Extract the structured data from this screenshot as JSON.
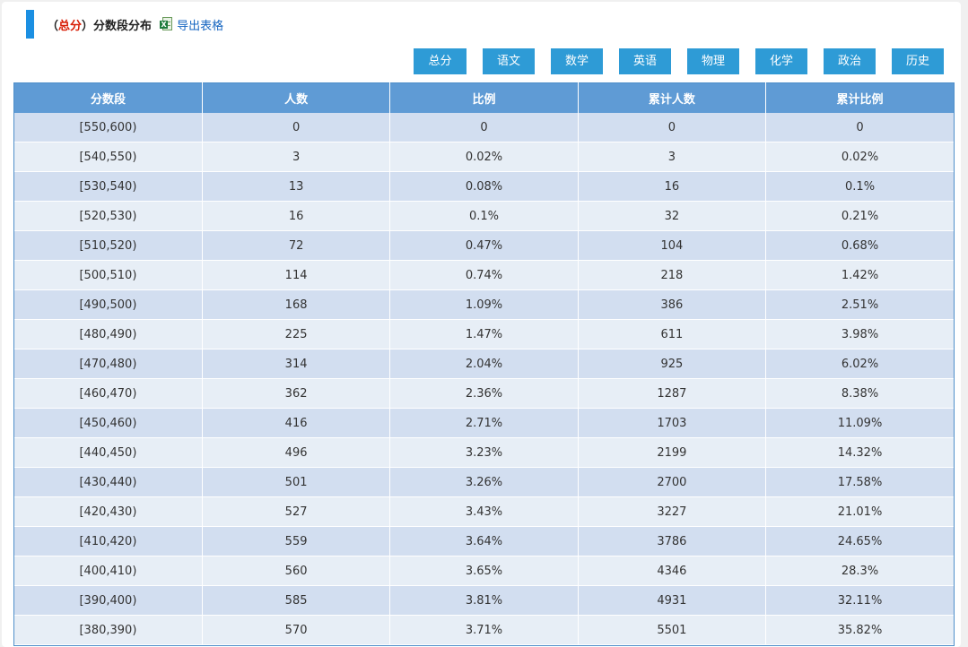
{
  "header": {
    "paren_open": "（",
    "subject": "总分",
    "paren_close": "）",
    "title": "分数段分布",
    "export_label": "导出表格",
    "export_icon": "excel-icon"
  },
  "subject_buttons": [
    "总分",
    "语文",
    "数学",
    "英语",
    "物理",
    "化学",
    "政治",
    "历史"
  ],
  "table": {
    "columns": [
      "分数段",
      "人数",
      "比例",
      "累计人数",
      "累计比例"
    ],
    "rows": [
      [
        "[550,600)",
        "0",
        "0",
        "0",
        "0"
      ],
      [
        "[540,550)",
        "3",
        "0.02%",
        "3",
        "0.02%"
      ],
      [
        "[530,540)",
        "13",
        "0.08%",
        "16",
        "0.1%"
      ],
      [
        "[520,530)",
        "16",
        "0.1%",
        "32",
        "0.21%"
      ],
      [
        "[510,520)",
        "72",
        "0.47%",
        "104",
        "0.68%"
      ],
      [
        "[500,510)",
        "114",
        "0.74%",
        "218",
        "1.42%"
      ],
      [
        "[490,500)",
        "168",
        "1.09%",
        "386",
        "2.51%"
      ],
      [
        "[480,490)",
        "225",
        "1.47%",
        "611",
        "3.98%"
      ],
      [
        "[470,480)",
        "314",
        "2.04%",
        "925",
        "6.02%"
      ],
      [
        "[460,470)",
        "362",
        "2.36%",
        "1287",
        "8.38%"
      ],
      [
        "[450,460)",
        "416",
        "2.71%",
        "1703",
        "11.09%"
      ],
      [
        "[440,450)",
        "496",
        "3.23%",
        "2199",
        "14.32%"
      ],
      [
        "[430,440)",
        "501",
        "3.26%",
        "2700",
        "17.58%"
      ],
      [
        "[420,430)",
        "527",
        "3.43%",
        "3227",
        "21.01%"
      ],
      [
        "[410,420)",
        "559",
        "3.64%",
        "3786",
        "24.65%"
      ],
      [
        "[400,410)",
        "560",
        "3.65%",
        "4346",
        "28.3%"
      ],
      [
        "[390,400)",
        "585",
        "3.81%",
        "4931",
        "32.11%"
      ],
      [
        "[380,390)",
        "570",
        "3.71%",
        "5501",
        "35.82%"
      ]
    ]
  },
  "colors": {
    "accent": "#1b8fe2",
    "subject_highlight": "#d81e06",
    "button_bg": "#2e9bd6",
    "header_bg": "#5f9bd5",
    "row_odd": "#d2def0",
    "row_even": "#e7eef6",
    "link": "#1565c0"
  }
}
